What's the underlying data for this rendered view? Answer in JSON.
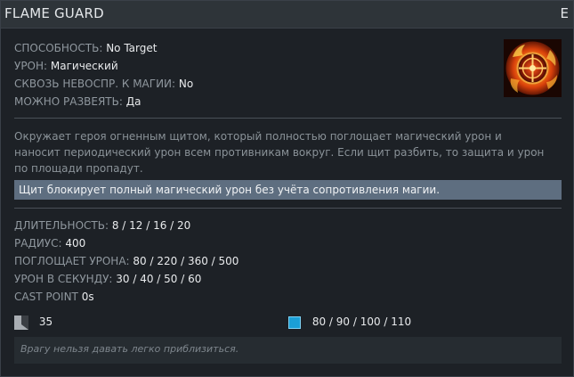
{
  "header": {
    "title": "FLAME GUARD",
    "hotkey": "E"
  },
  "properties": [
    {
      "label": "СПОСОБНОСТЬ:",
      "value": "No Target"
    },
    {
      "label": "УРОН:",
      "value": "Магический"
    },
    {
      "label": "СКВОЗЬ НЕВОСПР. К МАГИИ:",
      "value": "No"
    },
    {
      "label": "МОЖНО РАЗВЕЯТЬ:",
      "value": "Да"
    }
  ],
  "ability_icon": "flame-guard-icon",
  "description": "Окружает героя огненным щитом, который полностью поглощает магический урон и наносит периодический урон всем противникам вокруг. Если щит разбить, то защита и урон по площади пропадут.",
  "note": "Щит блокирует полный магический урон без учёта сопротивления магии.",
  "stats": [
    {
      "label": "ДЛИТЕЛЬНОСТЬ:",
      "value": "8 / 12 / 16 / 20"
    },
    {
      "label": "РАДИУС:",
      "value": "400"
    },
    {
      "label": "ПОГЛОЩАЕТ УРОНА:",
      "value": "80 / 220 / 360 / 500"
    },
    {
      "label": "УРОН В СЕКУНДУ:",
      "value": "30 / 40 / 50 / 60"
    },
    {
      "label": "CAST POINT",
      "value": "0s"
    }
  ],
  "cooldown": {
    "icon": "cooldown-icon",
    "value": "35"
  },
  "manacost": {
    "icon": "mana-icon",
    "value": "80 / 90 / 100 / 110",
    "color": "#1b9fd6"
  },
  "lore": "Врагу нельзя давать легко приблизиться.",
  "colors": {
    "header_bg": "#2e3439",
    "panel_bg": "#1d2126",
    "note_bg": "#5e6e80",
    "label": "#8f979e",
    "value": "#e8eaec"
  }
}
